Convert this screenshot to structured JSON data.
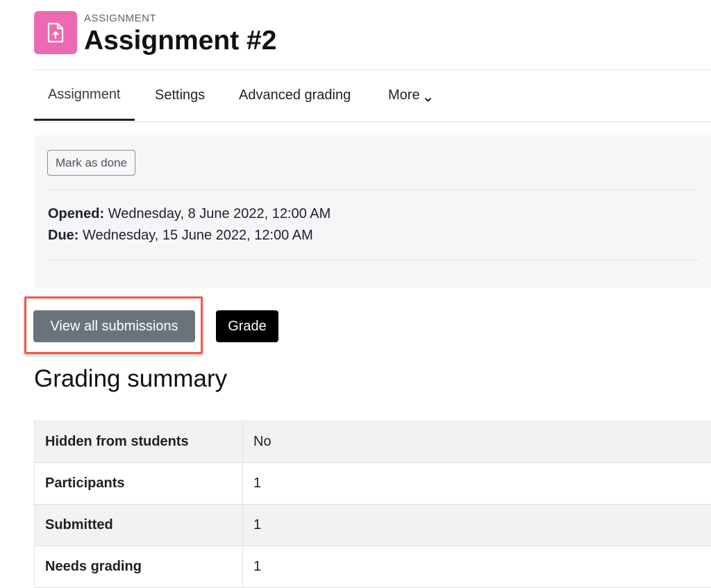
{
  "header": {
    "activity_type": "ASSIGNMENT",
    "title": "Assignment #2",
    "icon": "assignment-upload-icon",
    "icon_color": "#ec6ab2"
  },
  "tabs": [
    {
      "label": "Assignment",
      "active": true
    },
    {
      "label": "Settings",
      "active": false
    },
    {
      "label": "Advanced grading",
      "active": false
    },
    {
      "label": "More",
      "active": false,
      "icon": "chevron-down-icon"
    }
  ],
  "activity_info": {
    "mark_done_label": "Mark as done",
    "opened_label": "Opened:",
    "opened_value": "Wednesday, 8 June 2022, 12:00 AM",
    "due_label": "Due:",
    "due_value": "Wednesday, 15 June 2022, 12:00 AM"
  },
  "actions": {
    "view_submissions_label": "View all submissions",
    "grade_label": "Grade",
    "highlight_color": "#f05a4a"
  },
  "grading_summary": {
    "heading": "Grading summary",
    "rows": [
      {
        "label": "Hidden from students",
        "value": "No"
      },
      {
        "label": "Participants",
        "value": "1"
      },
      {
        "label": "Submitted",
        "value": "1"
      },
      {
        "label": "Needs grading",
        "value": "1"
      }
    ]
  }
}
